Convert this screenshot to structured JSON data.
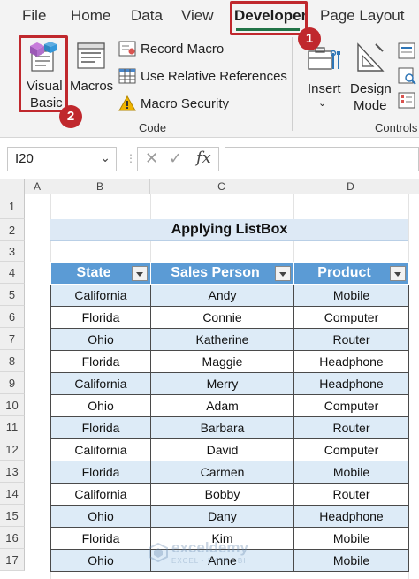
{
  "menu": {
    "tabs": [
      "File",
      "Home",
      "Data",
      "View",
      "Developer",
      "Page Layout"
    ],
    "active_tab": "Developer",
    "accent": "#217346"
  },
  "callouts": {
    "one": "1",
    "two": "2",
    "color": "#c0282d"
  },
  "ribbon": {
    "visual_basic": {
      "line1": "Visual",
      "line2": "Basic"
    },
    "macros": "Macros",
    "record_macro": "Record Macro",
    "use_relative": "Use Relative References",
    "macro_security": "Macro Security",
    "code_group": "Code",
    "insert": "Insert",
    "design_mode": {
      "line1": "Design",
      "line2": "Mode"
    },
    "controls_group": "Controls"
  },
  "formula_bar": {
    "name_box": "I20",
    "fx": "fx",
    "value": ""
  },
  "columns": [
    "A",
    "B",
    "C",
    "D"
  ],
  "rows": [
    "1",
    "2",
    "3",
    "4",
    "5",
    "6",
    "7",
    "8",
    "9",
    "10",
    "11",
    "12",
    "13",
    "14",
    "15",
    "16",
    "17"
  ],
  "sheet": {
    "title": "Applying ListBox",
    "headers": [
      "State",
      "Sales Person",
      "Product"
    ],
    "data": [
      [
        "California",
        "Andy",
        "Mobile"
      ],
      [
        "Florida",
        "Connie",
        "Computer"
      ],
      [
        "Ohio",
        "Katherine",
        "Router"
      ],
      [
        "Florida",
        "Maggie",
        "Headphone"
      ],
      [
        "California",
        "Merry",
        "Headphone"
      ],
      [
        "Ohio",
        "Adam",
        "Computer"
      ],
      [
        "Florida",
        "Barbara",
        "Router"
      ],
      [
        "California",
        "David",
        "Computer"
      ],
      [
        "Florida",
        "Carmen",
        "Mobile"
      ],
      [
        "California",
        "Bobby",
        "Router"
      ],
      [
        "Ohio",
        "Dany",
        "Headphone"
      ],
      [
        "Florida",
        "Kim",
        "Mobile"
      ],
      [
        "Ohio",
        "Anne",
        "Mobile"
      ]
    ],
    "header_color": "#5b9bd5",
    "band_color": "#ddebf7"
  },
  "watermark": {
    "name": "exceldemy",
    "sub": "EXCEL · DATA · BI"
  }
}
